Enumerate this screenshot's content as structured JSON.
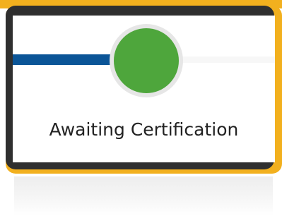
{
  "step": {
    "status_label": "Awaiting Certification",
    "state": "current"
  },
  "colors": {
    "accent_border": "#f2b01e",
    "progress_complete": "#0b5597",
    "status_circle": "#4ea63c",
    "progress_pending": "#f7f7f7"
  }
}
